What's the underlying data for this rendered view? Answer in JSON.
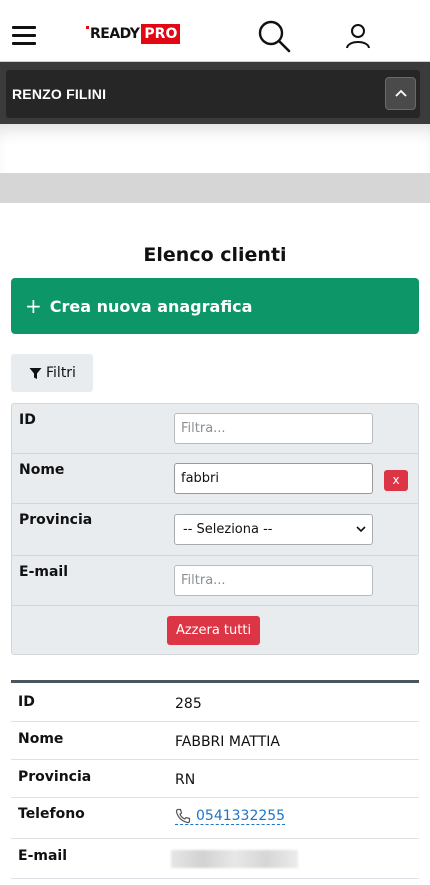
{
  "header": {
    "logo_ready": "READY",
    "logo_pro": "PRO",
    "menu_icon": "hamburger-icon",
    "search_icon": "search-icon",
    "user_icon": "user-icon"
  },
  "user_bar": {
    "name": "RENZO FILINI",
    "toggle_icon": "chevron-up-icon"
  },
  "page": {
    "title": "Elenco clienti",
    "create_button": "Crea nuova anagrafica",
    "filters_button": "Filtri"
  },
  "filters": {
    "id_label": "ID",
    "id_placeholder": "Filtra...",
    "name_label": "Nome",
    "name_value": "fabbri",
    "name_clear": "x",
    "province_label": "Provincia",
    "province_selected": "-- Seleziona --",
    "email_label": "E-mail",
    "email_placeholder": "Filtra...",
    "reset_button": "Azzera tutti"
  },
  "result": {
    "id_label": "ID",
    "id_value": "285",
    "name_label": "Nome",
    "name_value": "FABBRI MATTIA",
    "province_label": "Provincia",
    "province_value": "RN",
    "phone_label": "Telefono",
    "phone_value": "0541332255",
    "email_label": "E-mail"
  },
  "colors": {
    "brand_red": "#e30613",
    "create_green": "#0d9668",
    "danger_red": "#dc3545",
    "link_blue": "#1f74c9"
  }
}
